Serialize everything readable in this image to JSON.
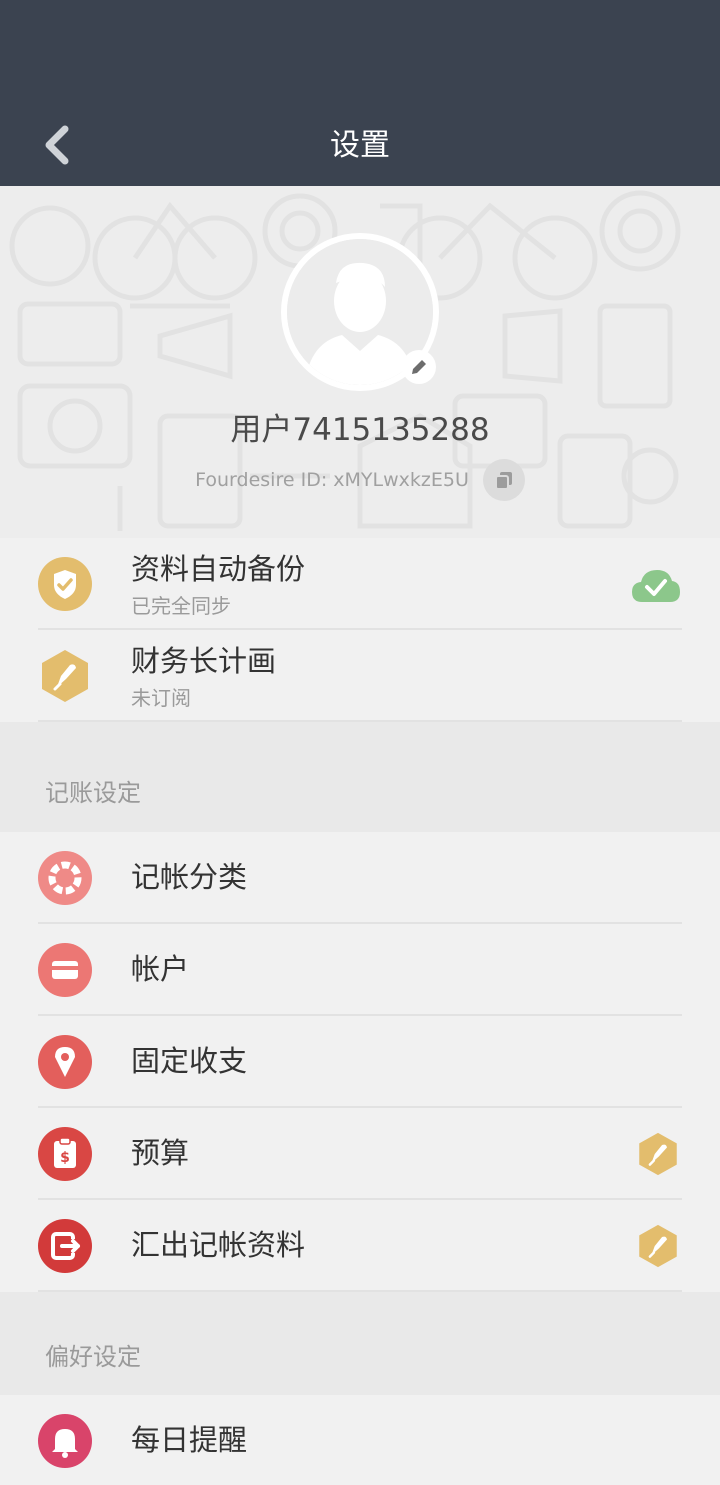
{
  "header": {
    "title": "设置"
  },
  "profile": {
    "username": "用户7415135288",
    "fourdesire_id": "Fourdesire ID: xMYLwxkzE5U"
  },
  "account_items": [
    {
      "label": "资料自动备份",
      "sub": "已完全同步",
      "icon": "shield-check-icon",
      "right_icon": "cloud-check-icon"
    },
    {
      "label": "财务长计画",
      "sub": "未订阅",
      "icon": "pen-nib-hexagon-icon"
    }
  ],
  "sections": [
    {
      "title": "记账设定",
      "items": [
        {
          "label": "记帐分类",
          "icon": "category-ring-icon",
          "color": "#ef8a87"
        },
        {
          "label": "帐户",
          "icon": "card-icon",
          "color": "#ec7774"
        },
        {
          "label": "固定收支",
          "icon": "fixed-pin-icon",
          "color": "#e35f5c"
        },
        {
          "label": "预算",
          "icon": "budget-clipboard-icon",
          "color": "#d94744",
          "premium_icon": "pen-nib-hexagon-icon"
        },
        {
          "label": "汇出记帐资料",
          "icon": "export-icon",
          "color": "#d23a3a",
          "premium_icon": "pen-nib-hexagon-icon"
        }
      ]
    },
    {
      "title": "偏好设定",
      "items": [
        {
          "label": "每日提醒",
          "icon": "bell-icon",
          "color": "#d9446a"
        }
      ]
    }
  ],
  "colors": {
    "header_bg": "#3b4350",
    "gold": "#e3bd6d",
    "cloud_green": "#8cc78b"
  }
}
